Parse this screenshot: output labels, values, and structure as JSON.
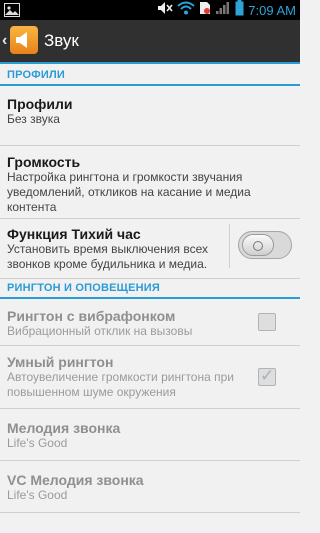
{
  "status_bar": {
    "time": "7:09 AM",
    "icons": [
      "gallery-icon",
      "mute-icon",
      "wifi-icon",
      "no-sim-icon",
      "signal-icon",
      "battery-icon"
    ]
  },
  "action_bar": {
    "title": "Звук",
    "icon": "sound-settings-icon"
  },
  "sections": {
    "profiles": {
      "header": "ПРОФИЛИ",
      "items": [
        {
          "title": "Профили",
          "subtitle": "Без звука"
        },
        {
          "title": "Громкость",
          "subtitle": "Настройка рингтона и громкости звучания уведомлений, откликов на касание и медиа контента"
        },
        {
          "title": "Функция Тихий час",
          "subtitle": "Установить время выключения всех звонков кроме будильника и медиа.",
          "toggle": "off"
        }
      ]
    },
    "ringtones": {
      "header": "РИНГТОН И ОПОВЕЩЕНИЯ",
      "items": [
        {
          "title": "Рингтон с вибрафонком",
          "subtitle": "Вибрационный отклик на вызовы",
          "checked": false
        },
        {
          "title": "Умный рингтон",
          "subtitle": "Автоувеличение громкости рингтона при повышенном шуме окружения",
          "checked": true
        },
        {
          "title": "Мелодия звонка",
          "subtitle": "Life's Good"
        },
        {
          "title": "VC Мелодия звонка",
          "subtitle": "Life's Good"
        }
      ]
    }
  },
  "colors": {
    "accent": "#2b9bd6",
    "action_bar": "#303030",
    "background": "#f1f1f1"
  }
}
